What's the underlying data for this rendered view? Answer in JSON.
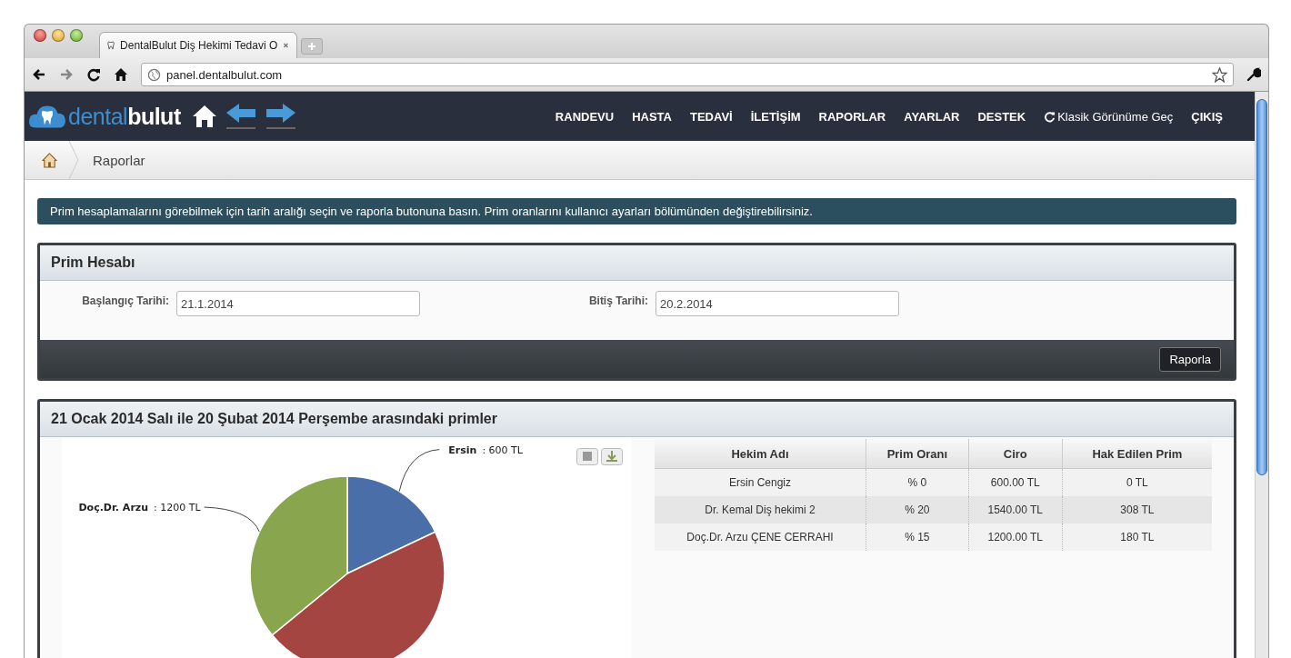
{
  "browser": {
    "tab_title": "DentalBulut Diş Hekimi Tedavi O",
    "url": "panel.dentalbulut.com"
  },
  "nav": {
    "logo": {
      "light": "dental",
      "bold": "bulut"
    },
    "items": [
      {
        "label": "RANDEVU",
        "kind": "link"
      },
      {
        "label": "HASTA",
        "kind": "link"
      },
      {
        "label": "TEDAVİ",
        "kind": "link"
      },
      {
        "label": "İLETİŞİM",
        "kind": "link"
      },
      {
        "label": "RAPORLAR",
        "kind": "link"
      },
      {
        "label": "AYARLAR",
        "kind": "link"
      },
      {
        "label": "DESTEK",
        "kind": "link"
      },
      {
        "label": "Klasik Görünüme Geç",
        "kind": "refresh"
      },
      {
        "label": "ÇIKIŞ",
        "kind": "link"
      }
    ]
  },
  "breadcrumb": [
    "Raporlar"
  ],
  "info": "Prim hesaplamalarını görebilmek için tarih aralığı seçin ve raporla butonuna basın. Prim oranlarını kullanıcı ayarları bölümünden değiştirebilirsiniz.",
  "prim_panel": {
    "title": "Prim Hesabı",
    "fields": [
      {
        "label": "Başlangıç Tarihi:",
        "value": "21.1.2014"
      },
      {
        "label": "Bitiş Tarihi:",
        "value": "20.2.2014"
      }
    ],
    "button": "Raporla"
  },
  "results": {
    "title": "21 Ocak 2014 Salı ile 20 Şubat 2014 Perşembe arasındaki primler",
    "chart_data": {
      "type": "pie",
      "values": [
        17.96,
        46.11,
        35.93
      ]
    },
    "slice_labels": [
      {
        "kind": "shown",
        "name": "Ersin",
        "value": ": 600 TL"
      },
      {
        "kind": "off-screen"
      },
      {
        "kind": "shown",
        "name": "Doç.Dr. Arzu",
        "value": ": 1200 TL"
      }
    ],
    "table": {
      "columns": [
        "Hekim Adı",
        "Prim Oranı",
        "Ciro",
        "Hak Edilen Prim"
      ],
      "rows": [
        [
          "Ersin Cengiz",
          "% 0",
          "600.00 TL",
          "0 TL"
        ],
        [
          "Dr. Kemal Diş hekimi 2",
          "% 20",
          "1540.00 TL",
          "308 TL"
        ],
        [
          "Doç.Dr. Arzu ÇENE CERRAHI",
          "% 15",
          "1200.00 TL",
          "180 TL"
        ]
      ]
    }
  }
}
